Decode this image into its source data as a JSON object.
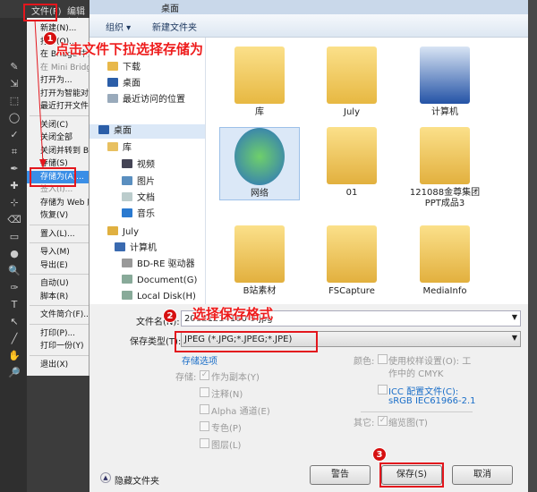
{
  "ps_menubar": {
    "file": "文件(F)",
    "edit": "编辑(E)"
  },
  "file_menu": [
    {
      "label": "新建(N)...",
      "state": "normal"
    },
    {
      "label": "打开(O)...",
      "state": "normal"
    },
    {
      "label": "在 Bridge 中浏览(B)...",
      "state": "normal"
    },
    {
      "label": "在 Mini Bridge 中浏览(G)...",
      "state": "disabled"
    },
    {
      "label": "打开为...",
      "state": "normal"
    },
    {
      "label": "打开为智能对象...",
      "state": "normal"
    },
    {
      "label": "最近打开文件(T)",
      "state": "normal"
    },
    {
      "label": "关闭(C)",
      "state": "normal"
    },
    {
      "label": "关闭全部",
      "state": "normal"
    },
    {
      "label": "关闭并转到 Bridge...",
      "state": "normal"
    },
    {
      "label": "存储(S)",
      "state": "normal"
    },
    {
      "label": "存储为(A)...",
      "state": "selected"
    },
    {
      "label": "签入(I)...",
      "state": "disabled"
    },
    {
      "label": "存储为 Web 所用格式...",
      "state": "normal"
    },
    {
      "label": "恢复(V)",
      "state": "normal"
    },
    {
      "label": "置入(L)...",
      "state": "normal"
    },
    {
      "label": "导入(M)",
      "state": "normal"
    },
    {
      "label": "导出(E)",
      "state": "normal"
    },
    {
      "label": "自动(U)",
      "state": "normal"
    },
    {
      "label": "脚本(R)",
      "state": "normal"
    },
    {
      "label": "文件简介(F)...",
      "state": "normal"
    },
    {
      "label": "打印(P)...",
      "state": "normal"
    },
    {
      "label": "打印一份(Y)",
      "state": "normal"
    },
    {
      "label": "退出(X)",
      "state": "normal"
    }
  ],
  "dialog": {
    "address": "桌面",
    "toolbar": {
      "organize": "组织 ▾",
      "new_folder": "新建文件夹"
    },
    "nav": [
      {
        "label": "下载",
        "icon": "download-folder-icon",
        "color": "#e8b84a"
      },
      {
        "label": "桌面",
        "icon": "desktop-icon",
        "color": "#2b5ea8"
      },
      {
        "label": "最近访问的位置",
        "icon": "recent-places-icon",
        "color": "#9ab"
      },
      {
        "label": "桌面",
        "icon": "desktop-icon",
        "color": "#2b5ea8"
      },
      {
        "label": "库",
        "icon": "library-icon",
        "color": "#e8c060"
      },
      {
        "label": "视频",
        "icon": "video-icon",
        "color": "#445"
      },
      {
        "label": "图片",
        "icon": "pictures-icon",
        "color": "#5a8fc0"
      },
      {
        "label": "文档",
        "icon": "documents-icon",
        "color": "#bcc"
      },
      {
        "label": "音乐",
        "icon": "music-icon",
        "color": "#2a7ad0"
      },
      {
        "label": "July",
        "icon": "user-folder-icon",
        "color": "#e0b040"
      },
      {
        "label": "计算机",
        "icon": "computer-icon",
        "color": "#3a6ab0"
      },
      {
        "label": "BD-RE 驱动器",
        "icon": "optical-drive-icon",
        "color": "#999"
      },
      {
        "label": "Document(G)",
        "icon": "drive-icon",
        "color": "#8a9"
      },
      {
        "label": "Local Disk(H)",
        "icon": "drive-icon",
        "color": "#8a9"
      }
    ],
    "files": [
      {
        "label": "库",
        "icon": "library-folder-icon"
      },
      {
        "label": "July",
        "icon": "user-folder-icon"
      },
      {
        "label": "计算机",
        "icon": "computer-icon"
      },
      {
        "label": "网络",
        "icon": "network-globe-icon"
      },
      {
        "label": "01",
        "icon": "folder-icon"
      },
      {
        "label": "121088金尊集团PPT成品3",
        "icon": "folder-icon"
      },
      {
        "label": "B站素材",
        "icon": "folder-icon"
      },
      {
        "label": "FSCapture",
        "icon": "folder-icon"
      },
      {
        "label": "MediaInfo",
        "icon": "folder-icon"
      }
    ],
    "filename_label": "文件名(N):",
    "filename_value": "20121214160-9.jpg",
    "filetype_label": "保存类型(T):",
    "filetype_value": "JPEG (*.JPG;*.JPEG;*.JPE)",
    "save_options_link": "存储选项",
    "store_label": "存储:",
    "options": [
      {
        "label": "作为副本(Y)",
        "checked": true
      },
      {
        "label": "注释(N)",
        "checked": false
      },
      {
        "label": "Alpha 通道(E)",
        "checked": false
      },
      {
        "label": "专色(P)",
        "checked": false
      },
      {
        "label": "图层(L)",
        "checked": false
      }
    ],
    "color_label": "颜色:",
    "proof_label": "使用校样设置(O): 工",
    "proof_label2": "作中的 CMYK",
    "icc_label": "ICC 配置文件(C):",
    "icc_value": "sRGB IEC61966-2.1",
    "other_label": "其它:",
    "thumbnail_label": "缩览图(T)",
    "hide_folders": "隐藏文件夹",
    "buttons": {
      "warning": "警告",
      "save": "保存(S)",
      "cancel": "取消"
    }
  },
  "annotations": {
    "step1": "点击文件下拉选择存储为",
    "step2": "选择保存格式",
    "badge1": "1",
    "badge2": "2",
    "badge3": "3",
    "color": "#e3161d"
  }
}
